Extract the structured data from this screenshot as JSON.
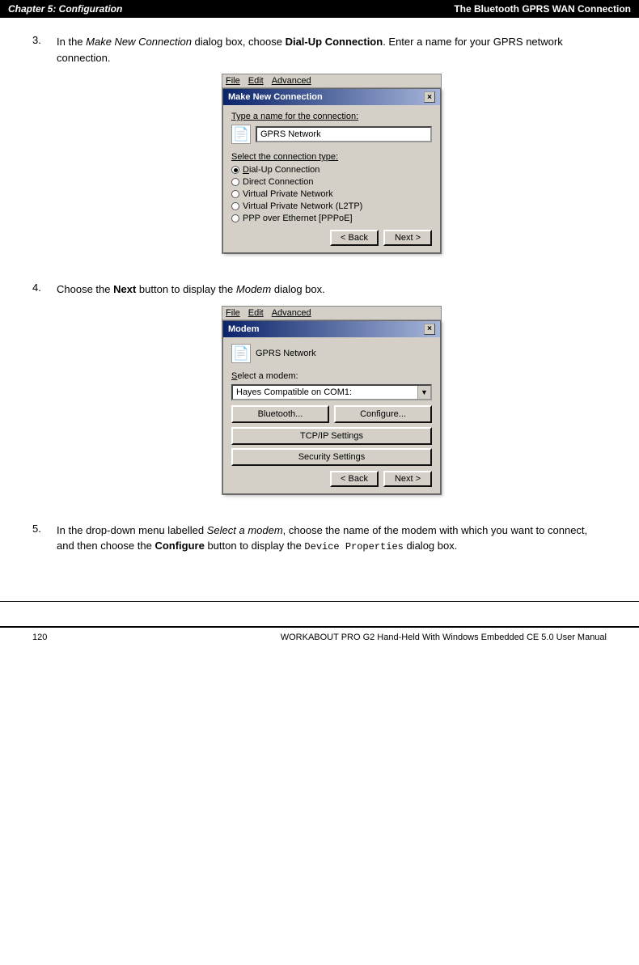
{
  "header": {
    "chapter": "Chapter  5:  Configuration",
    "section": "The Bluetooth GPRS WAN Connection"
  },
  "footer": {
    "page_left": "120",
    "page_text": "WORKABOUT PRO G2 Hand-Held With Windows Embedded CE 5.0 User Manual"
  },
  "step3": {
    "number": "3.",
    "text_part1": "In the ",
    "italic1": "Make New Connection",
    "text_part2": " dialog box, choose ",
    "bold1": "Dial-Up Connection",
    "text_part3": ". Enter a name for your GPRS network connection.",
    "dialog": {
      "menubar": [
        "File",
        "Edit",
        "Advanced"
      ],
      "title": "Make New Connection",
      "close_btn": "×",
      "label1": "Type a name for the connection:",
      "input_value": "GPRS Network",
      "label2": "Select the connection type:",
      "radio_options": [
        {
          "label": "Dial-Up Connection",
          "selected": true
        },
        {
          "label": "Direct Connection",
          "selected": false
        },
        {
          "label": "Virtual Private Network",
          "selected": false
        },
        {
          "label": "Virtual Private Network (L2TP)",
          "selected": false
        },
        {
          "label": "PPP over Ethernet [PPPoE]",
          "selected": false
        }
      ],
      "back_btn": "< Back",
      "next_btn": "Next >"
    }
  },
  "step4": {
    "number": "4.",
    "text_part1": "Choose the ",
    "bold1": "Next",
    "text_part2": " button to display the ",
    "italic1": "Modem",
    "text_part3": " dialog box.",
    "dialog": {
      "menubar": [
        "File",
        "Edit",
        "Advanced"
      ],
      "title": "Modem",
      "close_btn": "×",
      "network_name": "GPRS Network",
      "label1": "Select a modem:",
      "dropdown_value": "Hayes Compatible on COM1:",
      "btn_bluetooth": "Bluetooth...",
      "btn_configure": "Configure...",
      "btn_tcp": "TCP/IP Settings",
      "btn_security": "Security Settings",
      "back_btn": "< Back",
      "next_btn": "Next >"
    }
  },
  "step5": {
    "number": "5.",
    "text_part1": "In the drop-down menu labelled ",
    "italic1": "Select a modem",
    "text_part2": ", choose the name of the modem with which you want to connect, and then choose the ",
    "bold1": "Configure",
    "text_part3": " button to display the ",
    "code1": "Device  Properties",
    "text_part4": " dialog box."
  }
}
